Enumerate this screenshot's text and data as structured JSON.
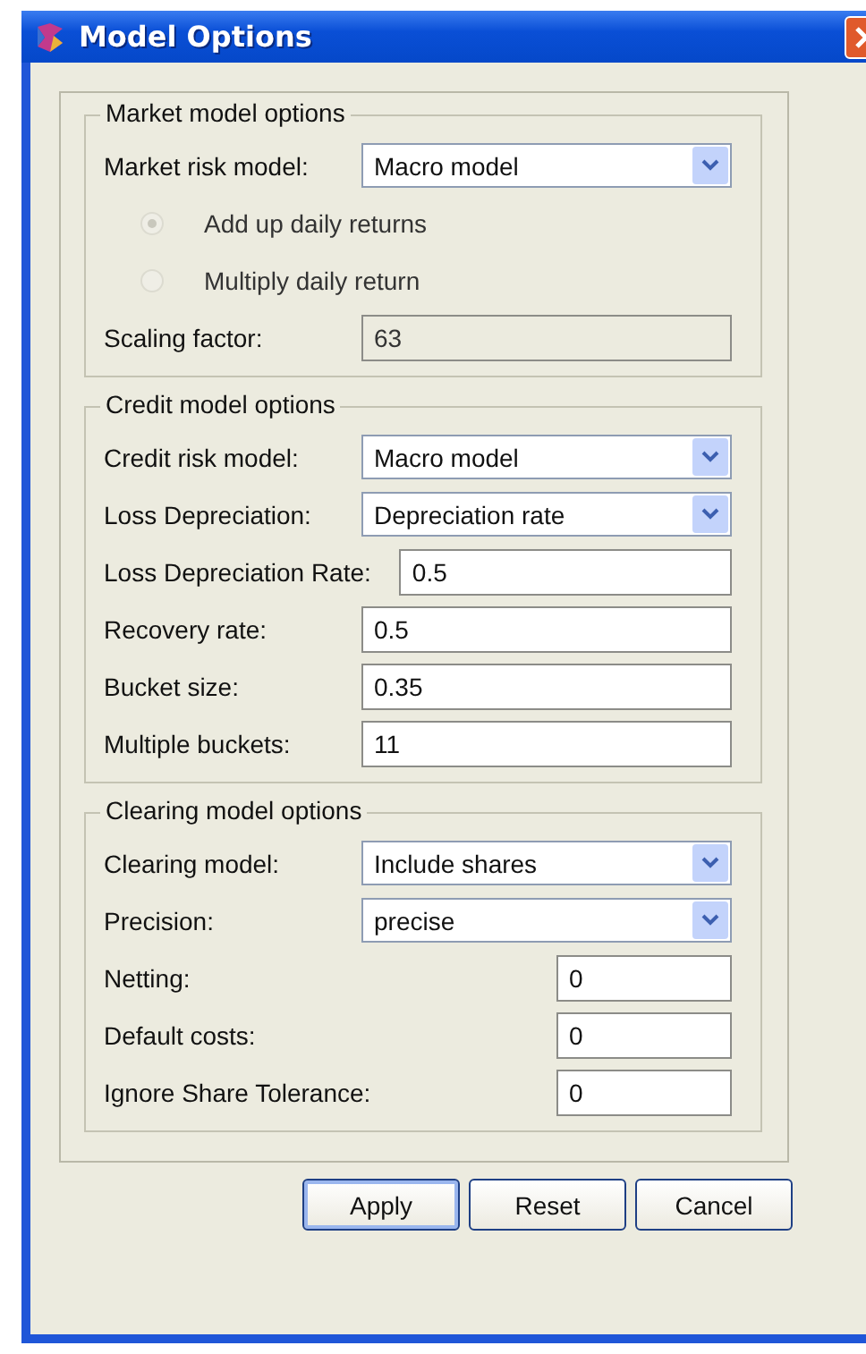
{
  "window": {
    "title": "Model Options"
  },
  "groups": [
    {
      "title": "Market model options",
      "rows": [
        {
          "kind": "combo",
          "label": "Market risk model:",
          "value": "Macro model",
          "disabled": false
        },
        {
          "kind": "radio",
          "label": "Add up daily returns",
          "selected": true,
          "disabled": true
        },
        {
          "kind": "radio",
          "label": "Multiply daily return",
          "selected": false,
          "disabled": true
        },
        {
          "kind": "field",
          "label": "Scaling factor:",
          "value": "63",
          "disabled": true
        }
      ]
    },
    {
      "title": "Credit model options",
      "rows": [
        {
          "kind": "combo",
          "label": "Credit risk model:",
          "value": "Macro model",
          "disabled": false
        },
        {
          "kind": "combo",
          "label": "Loss Depreciation:",
          "value": "Depreciation rate",
          "disabled": false
        },
        {
          "kind": "field_after_label",
          "label": "Loss Depreciation Rate:",
          "value": "0.5",
          "disabled": false
        },
        {
          "kind": "field",
          "label": "Recovery rate:",
          "value": "0.5",
          "disabled": false
        },
        {
          "kind": "field",
          "label": "Bucket size:",
          "value": "0.35",
          "disabled": false
        },
        {
          "kind": "field",
          "label": "Multiple buckets:",
          "value": "11",
          "disabled": false
        }
      ]
    },
    {
      "title": "Clearing model options",
      "rows": [
        {
          "kind": "combo",
          "label": "Clearing model:",
          "value": "Include shares",
          "disabled": false
        },
        {
          "kind": "combo",
          "label": "Precision:",
          "value": "precise",
          "disabled": false
        },
        {
          "kind": "field_right",
          "label": "Netting:",
          "value": "0",
          "disabled": false
        },
        {
          "kind": "field_right",
          "label": "Default costs:",
          "value": "0",
          "disabled": false
        },
        {
          "kind": "field_right",
          "label": "Ignore Share Tolerance:",
          "value": "0",
          "disabled": false
        }
      ]
    }
  ],
  "buttons": [
    {
      "label": "Apply",
      "default": true
    },
    {
      "label": "Reset",
      "default": false
    },
    {
      "label": "Cancel",
      "default": false
    }
  ]
}
